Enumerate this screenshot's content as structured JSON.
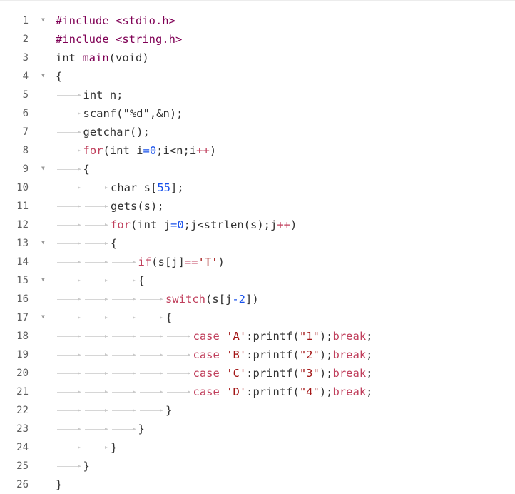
{
  "colors": {
    "line_number": "#5f5f5f",
    "fold_marker": "#9a9a9a",
    "plain": "#333333",
    "preprocessor": "#7f0055",
    "keyword": "#c03f5c",
    "number": "#1750eb",
    "string": "#a31515"
  },
  "icons": {
    "fold": "fold-arrow-icon",
    "tab": "tab-arrow-icon"
  },
  "lines": [
    {
      "n": "1",
      "fold": true,
      "tabs": 0,
      "tokens": [
        [
          "#include <stdio.h>",
          "meta"
        ]
      ]
    },
    {
      "n": "2",
      "fold": false,
      "tabs": 0,
      "tokens": [
        [
          "#include <string.h>",
          "meta"
        ]
      ]
    },
    {
      "n": "3",
      "fold": false,
      "tabs": 0,
      "tokens": [
        [
          "int ",
          "plain"
        ],
        [
          "main",
          "meta"
        ],
        [
          "(void)",
          "plain"
        ]
      ]
    },
    {
      "n": "4",
      "fold": true,
      "tabs": 0,
      "tokens": [
        [
          "{",
          "plain"
        ]
      ]
    },
    {
      "n": "5",
      "fold": false,
      "tabs": 1,
      "tokens": [
        [
          "int n;",
          "plain"
        ]
      ]
    },
    {
      "n": "6",
      "fold": false,
      "tabs": 1,
      "tokens": [
        [
          "scanf(\"%d\",&n);",
          "plain"
        ]
      ]
    },
    {
      "n": "7",
      "fold": false,
      "tabs": 1,
      "tokens": [
        [
          "getchar();",
          "plain"
        ]
      ]
    },
    {
      "n": "8",
      "fold": false,
      "tabs": 1,
      "tokens": [
        [
          "for",
          "kw"
        ],
        [
          "(int i",
          "plain"
        ],
        [
          "=0",
          "num"
        ],
        [
          ";i<n;i",
          "plain"
        ],
        [
          "++",
          "kw"
        ],
        [
          ")",
          "plain"
        ]
      ]
    },
    {
      "n": "9",
      "fold": true,
      "tabs": 1,
      "tokens": [
        [
          "{",
          "plain"
        ]
      ]
    },
    {
      "n": "10",
      "fold": false,
      "tabs": 2,
      "tokens": [
        [
          "char s[",
          "plain"
        ],
        [
          "55",
          "num"
        ],
        [
          "];",
          "plain"
        ]
      ]
    },
    {
      "n": "11",
      "fold": false,
      "tabs": 2,
      "tokens": [
        [
          "gets(s);",
          "plain"
        ]
      ]
    },
    {
      "n": "12",
      "fold": false,
      "tabs": 2,
      "tokens": [
        [
          "for",
          "kw"
        ],
        [
          "(int j",
          "plain"
        ],
        [
          "=0",
          "num"
        ],
        [
          ";j<strlen(s);j",
          "plain"
        ],
        [
          "++",
          "kw"
        ],
        [
          ")",
          "plain"
        ]
      ]
    },
    {
      "n": "13",
      "fold": true,
      "tabs": 2,
      "tokens": [
        [
          "{",
          "plain"
        ]
      ]
    },
    {
      "n": "14",
      "fold": false,
      "tabs": 3,
      "tokens": [
        [
          "if",
          "kw"
        ],
        [
          "(s[j]",
          "plain"
        ],
        [
          "==",
          "kw"
        ],
        [
          "'T'",
          "str"
        ],
        [
          ")",
          "plain"
        ]
      ]
    },
    {
      "n": "15",
      "fold": true,
      "tabs": 3,
      "tokens": [
        [
          "{",
          "plain"
        ]
      ]
    },
    {
      "n": "16",
      "fold": false,
      "tabs": 4,
      "tokens": [
        [
          "switch",
          "kw"
        ],
        [
          "(s[j",
          "plain"
        ],
        [
          "-2",
          "num"
        ],
        [
          "])",
          "plain"
        ]
      ]
    },
    {
      "n": "17",
      "fold": true,
      "tabs": 4,
      "tokens": [
        [
          "{",
          "plain"
        ]
      ]
    },
    {
      "n": "18",
      "fold": false,
      "tabs": 5,
      "tokens": [
        [
          "case ",
          "kw"
        ],
        [
          "'A'",
          "str"
        ],
        [
          ":printf(",
          "plain"
        ],
        [
          "\"1\"",
          "str"
        ],
        [
          ");",
          "plain"
        ],
        [
          "break",
          "kw"
        ],
        [
          ";",
          "plain"
        ]
      ]
    },
    {
      "n": "19",
      "fold": false,
      "tabs": 5,
      "tokens": [
        [
          "case ",
          "kw"
        ],
        [
          "'B'",
          "str"
        ],
        [
          ":printf(",
          "plain"
        ],
        [
          "\"2\"",
          "str"
        ],
        [
          ");",
          "plain"
        ],
        [
          "break",
          "kw"
        ],
        [
          ";",
          "plain"
        ]
      ]
    },
    {
      "n": "20",
      "fold": false,
      "tabs": 5,
      "tokens": [
        [
          "case ",
          "kw"
        ],
        [
          "'C'",
          "str"
        ],
        [
          ":printf(",
          "plain"
        ],
        [
          "\"3\"",
          "str"
        ],
        [
          ");",
          "plain"
        ],
        [
          "break",
          "kw"
        ],
        [
          ";",
          "plain"
        ]
      ]
    },
    {
      "n": "21",
      "fold": false,
      "tabs": 5,
      "tokens": [
        [
          "case ",
          "kw"
        ],
        [
          "'D'",
          "str"
        ],
        [
          ":printf(",
          "plain"
        ],
        [
          "\"4\"",
          "str"
        ],
        [
          ");",
          "plain"
        ],
        [
          "break",
          "kw"
        ],
        [
          ";",
          "plain"
        ]
      ]
    },
    {
      "n": "22",
      "fold": false,
      "tabs": 4,
      "tokens": [
        [
          "}",
          "plain"
        ]
      ]
    },
    {
      "n": "23",
      "fold": false,
      "tabs": 3,
      "tokens": [
        [
          "}",
          "plain"
        ]
      ]
    },
    {
      "n": "24",
      "fold": false,
      "tabs": 2,
      "tokens": [
        [
          "}",
          "plain"
        ]
      ]
    },
    {
      "n": "25",
      "fold": false,
      "tabs": 1,
      "tokens": [
        [
          "}",
          "plain"
        ]
      ]
    },
    {
      "n": "26",
      "fold": false,
      "tabs": 0,
      "tokens": [
        [
          "}",
          "plain"
        ]
      ]
    }
  ]
}
